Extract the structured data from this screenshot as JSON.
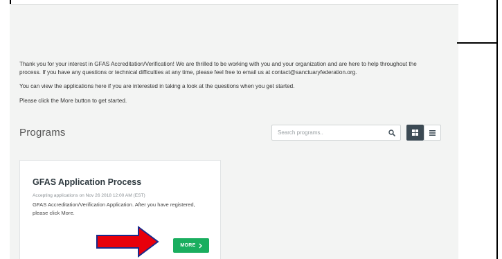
{
  "intro": {
    "paragraph_1": "Thank you for your interest in GFAS Accreditation/Verification! We are thrilled to be working with you and your organization and are here to help throughout the process. If you have any questions or technical difficulties at any time, please feel free to email us at contact@sanctuaryfederation.org.",
    "paragraph_2": "You can view the applications here if you are interested in taking a look at the questions when you get started.",
    "paragraph_3": "Please click the More button to get started."
  },
  "programs": {
    "title": "Programs",
    "search": {
      "placeholder": "Search programs..",
      "value": "",
      "icon": "search-icon"
    },
    "view_toggle": {
      "grid_icon": "grid-icon",
      "list_icon": "list-icon",
      "active": "grid"
    }
  },
  "cards": [
    {
      "title": "GFAS Application Process",
      "meta": "Accepting applications on Nov 26 2018 12:00 AM (EST)",
      "description": "GFAS Accreditation/Verification Application. After you have registered, please click More.",
      "button_label": "MORE"
    }
  ],
  "annotation": {
    "arrow_color": "#e8000b",
    "arrow_outline": "#1a2a8a"
  },
  "colors": {
    "accent_green": "#1aae5f",
    "dark_toggle": "#3c4a54",
    "page_bg": "#f3f4f3"
  }
}
